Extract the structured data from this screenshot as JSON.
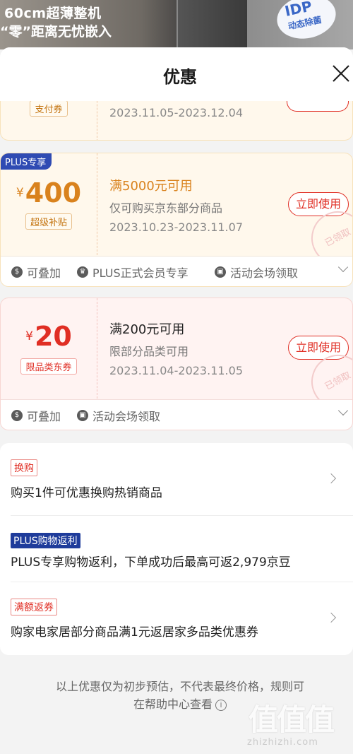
{
  "banner": {
    "line1": "60cm超薄整机",
    "line2": "“零”距离无忧嵌入",
    "badge_top": "IDP",
    "badge_bottom": "动态除菌"
  },
  "sheet": {
    "title": "优惠"
  },
  "coupons": [
    {
      "tag": "支付券",
      "dates": "2023.11.05-2023.12.04"
    },
    {
      "badge": "PLUS专享",
      "currency": "¥",
      "amount": "400",
      "tag": "超级补贴",
      "condition": "满5000元可用",
      "description": "仅可购买京东部分商品",
      "dates": "2023.10.23-2023.11.07",
      "button": "立即使用",
      "stamp": "已领取",
      "features": [
        "可叠加",
        "PLUS正式会员专享",
        "活动会场领取"
      ]
    },
    {
      "currency": "¥",
      "amount": "20",
      "tag": "限品类东券",
      "condition": "满200元可用",
      "description": "限部分品类可用",
      "dates": "2023.11.04-2023.11.05",
      "button": "立即使用",
      "stamp": "已领取",
      "features": [
        "可叠加",
        "活动会场领取"
      ]
    }
  ],
  "promos": [
    {
      "tag": "换购",
      "text": "购买1件可优惠换购热销商品"
    },
    {
      "tag": "PLUS购物返利",
      "text": "PLUS专享购物返利，下单成功后最高可返2,979京豆"
    },
    {
      "tag": "满额返券",
      "text": "购家电家居部分商品满1元返居家多品类优惠券"
    }
  ],
  "footer": {
    "note_line1": "以上优惠仅为初步预估，不代表最终价格，规则可",
    "note_line2": "在帮助中心查看"
  },
  "watermark": {
    "logo": "值值值",
    "site": "zhizhizhi.com"
  },
  "colors": {
    "accent_red": "#e02e24",
    "gold": "#d9821d",
    "plus_blue": "#2f4bb3"
  }
}
